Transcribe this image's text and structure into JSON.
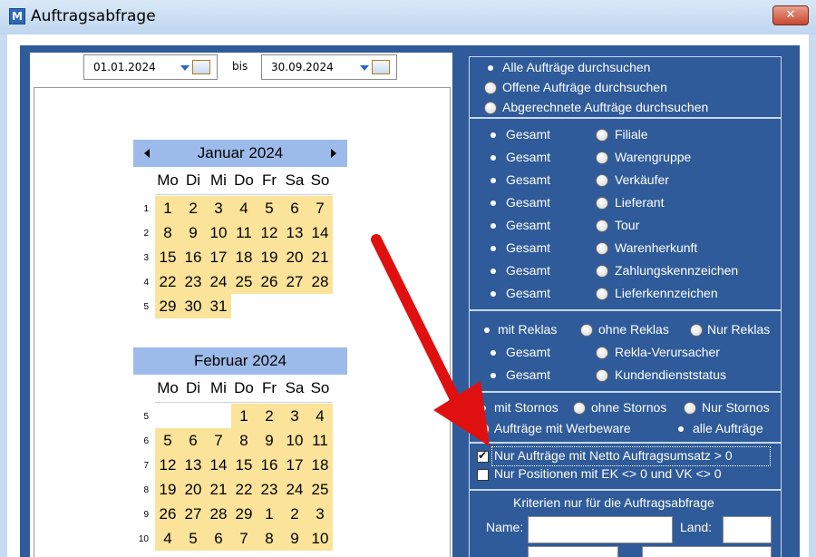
{
  "window": {
    "title": "Auftragsabfrage",
    "icon": "app-logo-icon",
    "icon_letter": "M",
    "close_label": "✕"
  },
  "date_range": {
    "from": "01.01.2024",
    "separator": "bis",
    "to": "30.09.2024"
  },
  "calendar": {
    "weekdays": [
      "Mo",
      "Di",
      "Mi",
      "Do",
      "Fr",
      "Sa",
      "So"
    ],
    "months": [
      {
        "title": "Januar 2024",
        "has_nav": true,
        "weeks": [
          {
            "num": "1",
            "days": [
              "1",
              "2",
              "3",
              "4",
              "5",
              "6",
              "7"
            ]
          },
          {
            "num": "2",
            "days": [
              "8",
              "9",
              "10",
              "11",
              "12",
              "13",
              "14"
            ]
          },
          {
            "num": "3",
            "days": [
              "15",
              "16",
              "17",
              "18",
              "19",
              "20",
              "21"
            ]
          },
          {
            "num": "4",
            "days": [
              "22",
              "23",
              "24",
              "25",
              "26",
              "27",
              "28"
            ]
          },
          {
            "num": "5",
            "days": [
              "29",
              "30",
              "31",
              "",
              "",
              "",
              ""
            ]
          }
        ]
      },
      {
        "title": "Februar 2024",
        "has_nav": false,
        "weeks": [
          {
            "num": "5",
            "days": [
              "",
              "",
              "",
              "1",
              "2",
              "3",
              "4"
            ]
          },
          {
            "num": "6",
            "days": [
              "5",
              "6",
              "7",
              "8",
              "9",
              "10",
              "11"
            ]
          },
          {
            "num": "7",
            "days": [
              "12",
              "13",
              "14",
              "15",
              "16",
              "17",
              "18"
            ]
          },
          {
            "num": "8",
            "days": [
              "19",
              "20",
              "21",
              "22",
              "23",
              "24",
              "25"
            ]
          },
          {
            "num": "9",
            "days": [
              "26",
              "27",
              "28",
              "29",
              "1",
              "2",
              "3"
            ]
          },
          {
            "num": "10",
            "days": [
              "4",
              "5",
              "6",
              "7",
              "8",
              "9",
              "10"
            ]
          }
        ]
      }
    ]
  },
  "search_scope": {
    "options": [
      {
        "label": "Alle Aufträge durchsuchen",
        "selected": true
      },
      {
        "label": "Offene Aufträge durchsuchen",
        "selected": false
      },
      {
        "label": "Abgerechnete Aufträge durchsuchen",
        "selected": false
      }
    ]
  },
  "filters": {
    "gesamt_label": "Gesamt",
    "rows": [
      {
        "label": "Filiale"
      },
      {
        "label": "Warengruppe"
      },
      {
        "label": "Verkäufer"
      },
      {
        "label": "Lieferant"
      },
      {
        "label": "Tour"
      },
      {
        "label": "Warenherkunft"
      },
      {
        "label": "Zahlungskennzeichen"
      },
      {
        "label": "Lieferkennzeichen"
      }
    ]
  },
  "reklas": {
    "mode": [
      "mit Reklas",
      "ohne Reklas",
      "Nur Reklas"
    ],
    "mode_selected": 0,
    "gesamt_label": "Gesamt",
    "rows": [
      {
        "label": "Rekla-Verursacher"
      },
      {
        "label": "Kundendienststatus"
      }
    ]
  },
  "stornos": {
    "mode": [
      "mit Stornos",
      "ohne Stornos",
      "Nur Stornos"
    ],
    "mode_selected": 0,
    "werbe": [
      "Aufträge mit Werbeware",
      "alle Aufträge"
    ],
    "werbe_selected": 1
  },
  "checkboxes": [
    {
      "label": "Nur Aufträge mit Netto Auftragsumsatz > 0",
      "checked": true
    },
    {
      "label": "Nur Positionen mit EK <> 0 und VK <> 0",
      "checked": false
    }
  ],
  "criteria": {
    "title": "Kriterien nur für die Auftragsabfrage",
    "name_label": "Name:",
    "land_label": "Land:",
    "name_value": "",
    "land_value": ""
  },
  "annotation": {
    "color": "#e01010"
  }
}
